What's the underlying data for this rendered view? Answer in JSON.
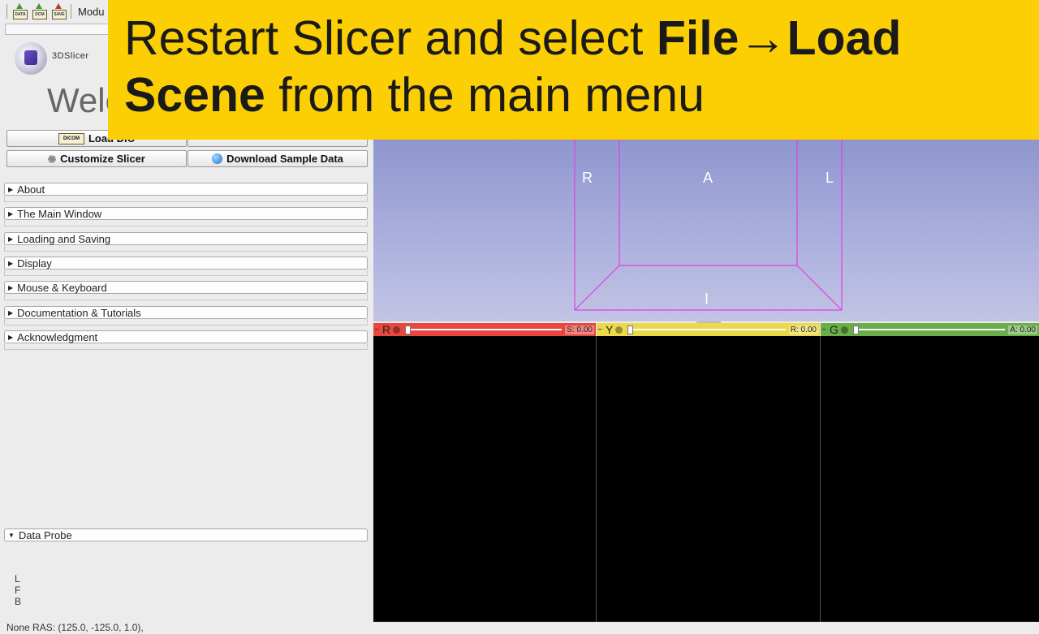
{
  "toolbar": {
    "icons": [
      "load-data-icon",
      "load-dicom-icon",
      "save-icon"
    ],
    "icon_labels": {
      "data": "DATA",
      "dcm": "DCM",
      "save": "SAVE"
    },
    "modules_label": "Modu"
  },
  "logo": {
    "text": "3DSlicer"
  },
  "welcome": {
    "title": "Welc"
  },
  "buttons": {
    "load_dicom": "Load DIC",
    "dicom_icon_label": "DICOM",
    "customize": "Customize Slicer",
    "download_sample": "Download Sample Data"
  },
  "panels": [
    {
      "label": "About",
      "expanded": false
    },
    {
      "label": "The Main Window",
      "expanded": false
    },
    {
      "label": "Loading and Saving",
      "expanded": false
    },
    {
      "label": "Display",
      "expanded": false
    },
    {
      "label": "Mouse & Keyboard",
      "expanded": false
    },
    {
      "label": "Documentation & Tutorials",
      "expanded": false
    },
    {
      "label": "Acknowledgment",
      "expanded": false
    }
  ],
  "data_probe": {
    "label": "Data Probe",
    "expanded": true,
    "lines": [
      "L",
      "F",
      "B"
    ],
    "ras": "None RAS: (125.0, -125.0, 1.0),"
  },
  "view3d": {
    "labels": {
      "right": "R",
      "anterior": "A",
      "left": "L",
      "inferior": "I"
    },
    "box_color": "#e040e0"
  },
  "slices": [
    {
      "letter": "R",
      "value": "S: 0.00",
      "color": "#e8463f"
    },
    {
      "letter": "Y",
      "value": "R: 0.00",
      "color": "#ecd94a"
    },
    {
      "letter": "G",
      "value": "A: 0.00",
      "color": "#6aae4a"
    }
  ],
  "overlay": {
    "prefix": "Restart Slicer and select ",
    "bold1": "File→Load Scene",
    "suffix": " from the main menu",
    "bg": "#fccf05"
  }
}
